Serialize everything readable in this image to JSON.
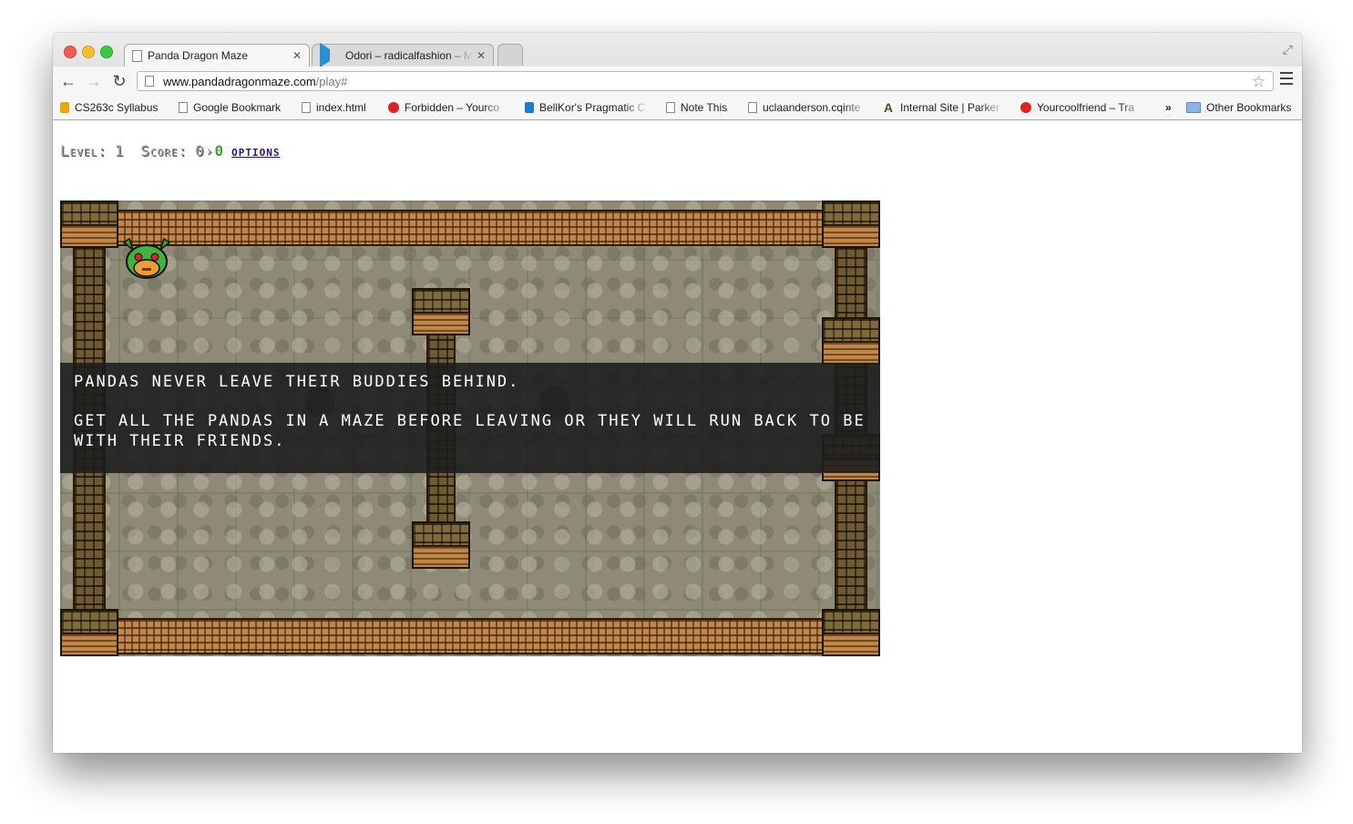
{
  "browser": {
    "tabs": [
      {
        "title": "Panda Dragon Maze",
        "active": true,
        "icon": "page-icon"
      },
      {
        "title": "Odori – radicalfashion – My",
        "active": false,
        "icon": "play-icon"
      }
    ],
    "url": {
      "host": "www.pandadragonmaze.com",
      "path": "/play#"
    },
    "bookmarks": [
      {
        "label": "CS263c Syllabus",
        "icon": "yellow-icon"
      },
      {
        "label": "Google Bookmark",
        "icon": "page-icon"
      },
      {
        "label": "index.html",
        "icon": "page-icon"
      },
      {
        "label": "Forbidden – Yourco",
        "icon": "paw-icon"
      },
      {
        "label": "BellKor's Pragmatic C",
        "icon": "globe-icon"
      },
      {
        "label": "Note This",
        "icon": "page-icon"
      },
      {
        "label": "uclaanderson.cqinte",
        "icon": "page-icon"
      },
      {
        "label": "Internal Site | Parker",
        "icon": "letter-a-icon"
      },
      {
        "label": "Yourcoolfriend – Tra",
        "icon": "paw-icon"
      }
    ],
    "overflow": "»",
    "other_bookmarks": "Other Bookmarks"
  },
  "hud": {
    "level_label": "Level:",
    "level": "1",
    "score_label": "Score:",
    "score_pandas": "0",
    "score_sep": "›",
    "score_total": "0",
    "options": "options"
  },
  "message": {
    "line1": "Pandas never leave their buddies behind.",
    "line2": "Get all the pandas in a maze before leaving or they will run back to be with their friends."
  }
}
